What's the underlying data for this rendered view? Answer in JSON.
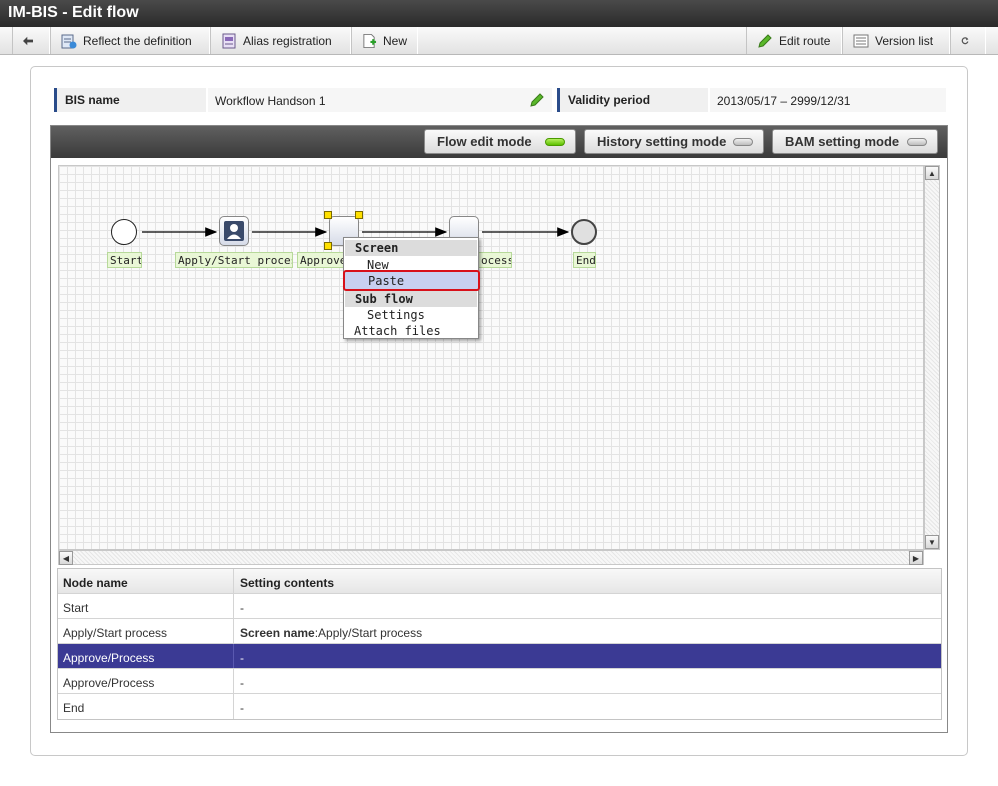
{
  "window": {
    "title": "IM-BIS - Edit flow"
  },
  "toolbar": {
    "reflect_label": "Reflect the definition",
    "alias_label": "Alias registration",
    "new_label": "New",
    "edit_route_label": "Edit route",
    "version_list_label": "Version list"
  },
  "info": {
    "bis_name_label": "BIS name",
    "bis_name_value": "Workflow Handson 1",
    "validity_label": "Validity period",
    "validity_value": "2013/05/17 – 2999/12/31"
  },
  "modes": {
    "flow_edit": "Flow edit mode",
    "history_setting": "History setting mode",
    "bam_setting": "BAM setting mode"
  },
  "flow": {
    "nodes": [
      "Start",
      "Apply/Start process",
      "Approve/",
      "ocess",
      "End"
    ]
  },
  "context_menu": {
    "screen_header": "Screen",
    "new_item": "New",
    "paste_item": "Paste",
    "subflow_header": "Sub flow",
    "settings_item": "Settings",
    "attach_item": "Attach files"
  },
  "table": {
    "headers": [
      "Node name",
      "Setting contents"
    ],
    "rows": [
      {
        "node": "Start",
        "setting": "-",
        "setting_bold": ""
      },
      {
        "node": "Apply/Start process",
        "setting_bold": "Screen name",
        "setting": ":Apply/Start process"
      },
      {
        "node": "Approve/Process",
        "setting": "-",
        "setting_bold": ""
      },
      {
        "node": "Approve/Process",
        "setting": "-",
        "setting_bold": ""
      },
      {
        "node": "End",
        "setting": "-",
        "setting_bold": ""
      }
    ]
  },
  "colors": {
    "selected_row": "#3b3a94",
    "highlight_border": "#d8101a",
    "node_label_bg": "#e9f7d6"
  }
}
